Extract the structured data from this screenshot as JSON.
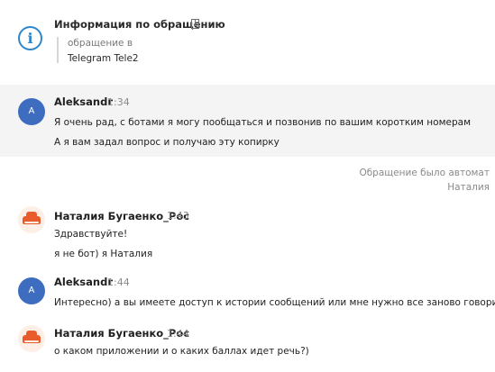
{
  "info": {
    "icon": "info-circle-icon",
    "title": "Информация по обращению",
    "bookmark_icon": "bookmark-icon",
    "subtitle": "обращение в",
    "channel": "Telegram Tele2"
  },
  "messages": [
    {
      "author": "Aleksandr",
      "avatar_letter": "A",
      "time": "1:34",
      "lines": [
        "Я очень рад, с ботами я могу пообщаться и позвонив по вашим коротким номерам",
        "А я вам задал вопрос и получаю эту копирку"
      ]
    },
    {
      "author": "Наталия Бугаенко_Рос",
      "avatar_icon": "car-icon",
      "time": "1:43",
      "lines": [
        "Здравствуйте!",
        "я не бот) я Наталия"
      ]
    },
    {
      "author": "Aleksandr",
      "avatar_letter": "A",
      "time": "1:44",
      "lines": [
        "Интересно) а вы имеете доступ к истории сообщений или мне нужно все заново говорить?"
      ]
    },
    {
      "author": "Наталия Бугаенко_Рос",
      "avatar_icon": "car-icon",
      "time": "1:44",
      "lines": [
        "о каком приложении и о каких баллах идет речь?)"
      ]
    }
  ],
  "system_note": {
    "line1": "Обращение было автомат",
    "line2": "Наталия"
  },
  "colors": {
    "accent": "#2f86c9",
    "avatar_blue": "#3e6dc0",
    "avatar_orange": "#e95b2b",
    "highlight_bg": "#f4f4f4"
  }
}
